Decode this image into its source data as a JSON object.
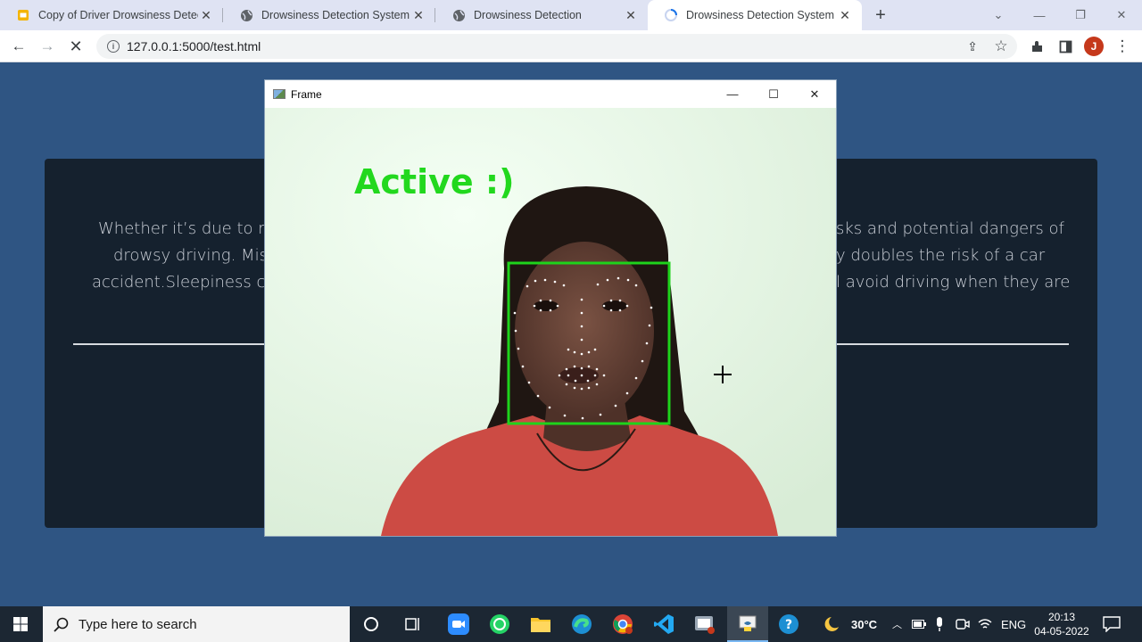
{
  "browser": {
    "tabs": [
      {
        "title": "Copy of Driver Drowsiness Detec",
        "icon": "slides-icon"
      },
      {
        "title": "Drowsiness Detection System",
        "icon": "globe-icon"
      },
      {
        "title": "Drowsiness Detection",
        "icon": "globe-icon"
      },
      {
        "title": "Drowsiness Detection System",
        "icon": "loading-spinner-icon",
        "active": true
      }
    ],
    "url": "127.0.0.1:5000/test.html",
    "profile_initial": "J"
  },
  "page": {
    "para_left": [
      "Whether it’s due to me",
      "drowsy driving. Miss",
      "accident.Sleepiness can"
    ],
    "para_right": [
      "sks and potential dangers of",
      "y doubles the risk of a car",
      "l avoid driving when they are"
    ]
  },
  "frame_window": {
    "title": "Frame",
    "status_text": "Active :)"
  },
  "taskbar": {
    "search_placeholder": "Type here to search",
    "weather": "30°C",
    "language": "ENG",
    "time": "20:13",
    "date": "04-05-2022"
  },
  "colors": {
    "page_bg": "#2f5583",
    "panel_bg": "#15212e",
    "detection_box": "#1ed31b",
    "status_text": "#22d81e"
  }
}
